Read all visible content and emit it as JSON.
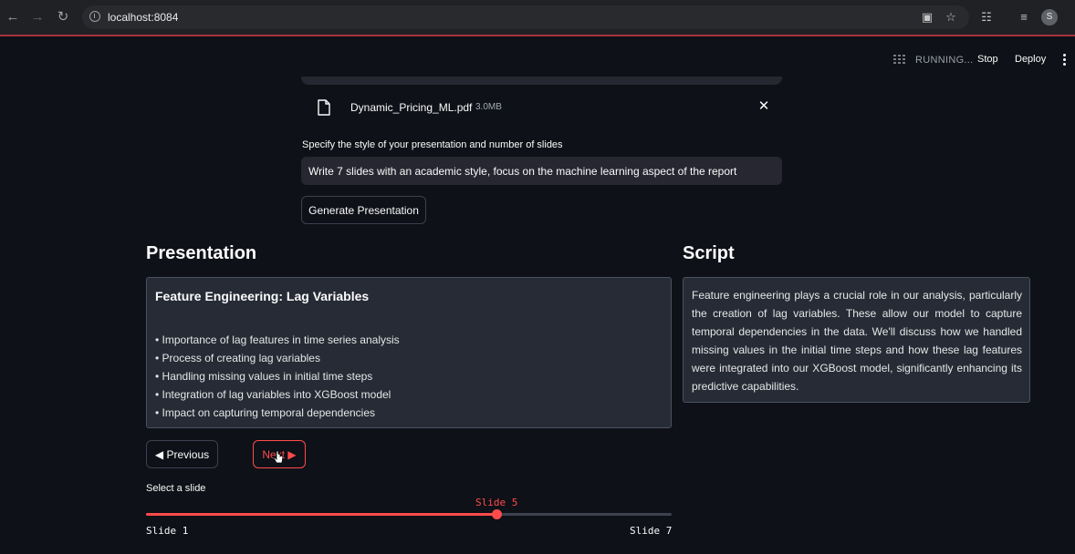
{
  "browser": {
    "url": "localhost:8084",
    "profile_initial": "S"
  },
  "app_header": {
    "status": "RUNNING...",
    "stop_label": "Stop",
    "deploy_label": "Deploy"
  },
  "uploaded_file": {
    "name": "Dynamic_Pricing_ML.pdf",
    "size": "3.0MB"
  },
  "prompt": {
    "label": "Specify the style of your presentation and number of slides",
    "value": "Write 7 slides with an academic style, focus on the machine learning aspect of the report"
  },
  "generate_label": "Generate Presentation",
  "presentation": {
    "heading": "Presentation",
    "slide_title": "Feature Engineering: Lag Variables",
    "bullets": [
      "• Importance of lag features in time series analysis",
      "• Process of creating lag variables",
      "• Handling missing values in initial time steps",
      "• Integration of lag variables into XGBoost model",
      "• Impact on capturing temporal dependencies"
    ]
  },
  "script": {
    "heading": "Script",
    "text": "Feature engineering plays a crucial role in our analysis, particularly the creation of lag variables. These allow our model to capture temporal dependencies in the data. We'll discuss how we handled missing values in the initial time steps and how these lag features were integrated into our XGBoost model, significantly enhancing its predictive capabilities."
  },
  "navigation": {
    "previous_label": "◀ Previous",
    "next_label": "Next ▶"
  },
  "slider": {
    "label": "Select a slide",
    "current_label": "Slide 5",
    "min_label": "Slide 1",
    "max_label": "Slide 7",
    "current": 5,
    "min": 1,
    "max": 7
  },
  "colors": {
    "accent": "#ff4b4b",
    "background": "#0e1117",
    "panel": "#262b36"
  }
}
